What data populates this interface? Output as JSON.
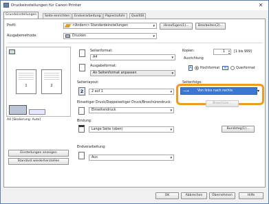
{
  "window": {
    "title": "Druckeinstellungen für Canon Printer",
    "close": "✕"
  },
  "tabs": [
    "Grundeinstellungen",
    "Seite einrichten",
    "Endverarbeitung",
    "Papierzufuhr",
    "Qualität"
  ],
  "profile": {
    "label": "Profil:",
    "value": "<Ändern> Standardeinstellungen",
    "add": "Hinzufügen(1)...",
    "edit": "Bearbeiten(2)..."
  },
  "output": {
    "label": "Ausgabemethode:",
    "value": "Drucken"
  },
  "pageformat": {
    "label": "Seitenformat:",
    "value": "A4"
  },
  "outformat": {
    "label": "Ausgabeformat:",
    "value": "An Seitenformat anpassen"
  },
  "copies": {
    "label": "Kopien:",
    "value": "1",
    "range": "[1 bis 999]"
  },
  "orientation": {
    "label": "Ausrichtung",
    "portrait": "Hochformat",
    "landscape": "Querformat"
  },
  "layout": {
    "label": "Seitenlayout:",
    "value": "2 auf 1"
  },
  "pageorder": {
    "label": "Seitenfolge:",
    "value": "Von links nach rechts"
  },
  "duplex": {
    "label": "Einseitiger Druck/Doppelseitiger Druck/Broschürendruck:",
    "value": "Einseitendruck",
    "brochure": "Broschüre..."
  },
  "binding": {
    "label": "Bindung:",
    "value": "Lange Seite (oben)",
    "gutter": "Bundsteg(1)..."
  },
  "finishing": {
    "label": "Endverarbeitung:",
    "value": "Aus"
  },
  "preview": {
    "pages": [
      "1",
      "2"
    ],
    "caption": "A4 [Skalierung: Auto]"
  },
  "left_buttons": {
    "show": "Einstellungen anzeigen",
    "reset": "Standard wiederherstellen"
  },
  "footer": {
    "ok": "OK",
    "cancel": "Abbrechen",
    "apply": "Übernehmen",
    "help": "Hilfe"
  }
}
